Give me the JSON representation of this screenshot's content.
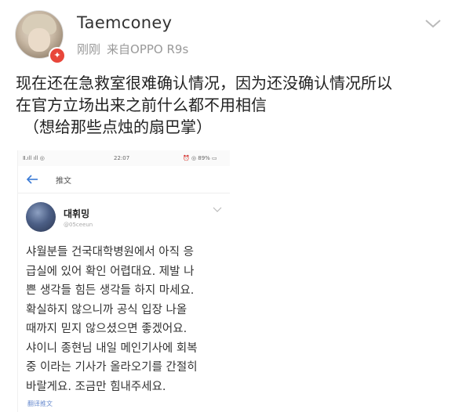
{
  "user": {
    "username": "Taemconey",
    "time": "刚刚",
    "source": "来自OPPO R9s",
    "badge_icon": "verified-badge-icon"
  },
  "post": {
    "lines": [
      "现在还在急救室很难确认情况，因为还没确认情况所以",
      "在官方立场出来之前什么都不用相信",
      "（想给那些点烛的扇巴掌）"
    ]
  },
  "embedded_screenshot": {
    "status_bar": {
      "left": "Ⅱ.ıll ıll ◎",
      "time": "22:07",
      "right": "⏰ ◎ 89% ▭"
    },
    "app_bar": {
      "back_icon": "back-arrow-icon",
      "title": "推文"
    },
    "tweet": {
      "name": "대휘밍",
      "handle": "@05ceeun",
      "lines": [
        "샤월분들 건국대학병원에서 아직 응",
        "급실에 있어 확인 어렵대요. 제발 나",
        "쁜 생각들 힘든 생각들 하지 마세요.",
        "확실하지 않으니까 공식 입장 나올",
        "때까지 믿지 않으셨으면 좋겠어요.",
        "샤이니 종현님 내일 메인기사에 회복",
        "중 이라는 기사가 올라오기를 간절히",
        "바랄게요. 조금만 힘내주세요."
      ],
      "translate_link": "翻译推文"
    }
  },
  "colors": {
    "badge": "#e8463a",
    "link": "#6a8ccf",
    "meta_text": "#999999"
  }
}
